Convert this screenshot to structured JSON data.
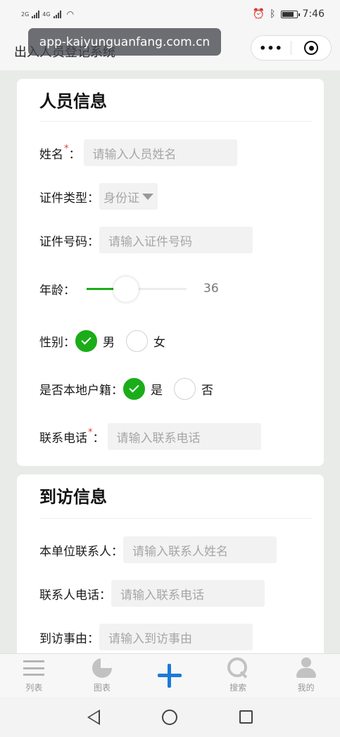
{
  "status_bar": {
    "network_left": "2G",
    "network_right": "4G",
    "time": "7:46"
  },
  "header": {
    "title": "出入人员登记系统",
    "url_overlay": "app-kaiyunguanfang.com.cn",
    "more_label": "•••"
  },
  "person_section": {
    "title": "人员信息",
    "name_label": "姓名",
    "required_mark": "*",
    "colon": "：",
    "name_placeholder": "请输入人员姓名",
    "id_type_label": "证件类型：",
    "id_type_value": "身份证",
    "id_number_label": "证件号码：",
    "id_number_placeholder": "请输入证件号码",
    "age_label": "年龄：",
    "age_value": "36",
    "age_slider_fraction": 0.36,
    "gender_label": "性别：",
    "gender_options": [
      "男",
      "女"
    ],
    "gender_selected": "男",
    "local_label": "是否本地户籍：",
    "local_options": [
      "是",
      "否"
    ],
    "local_selected": "是",
    "phone_label": "联系电话",
    "phone_placeholder": "请输入联系电话"
  },
  "visit_section": {
    "title": "到访信息",
    "contact_label": "本单位联系人：",
    "contact_placeholder": "请输入联系人姓名",
    "contact_phone_label": "联系人电话：",
    "contact_phone_placeholder": "请输入联系电话",
    "reason_label": "到访事由：",
    "reason_placeholder": "请输入到访事由"
  },
  "tabbar": {
    "items": [
      {
        "label": "列表",
        "icon": "list-icon"
      },
      {
        "label": "图表",
        "icon": "pie-chart-icon"
      },
      {
        "label": "",
        "icon": "plus-icon"
      },
      {
        "label": "搜索",
        "icon": "search-icon"
      },
      {
        "label": "我的",
        "icon": "person-icon"
      }
    ]
  },
  "colors": {
    "accent_green": "#1aad19",
    "accent_blue": "#1b7ad8",
    "required_red": "#e13b3b"
  }
}
